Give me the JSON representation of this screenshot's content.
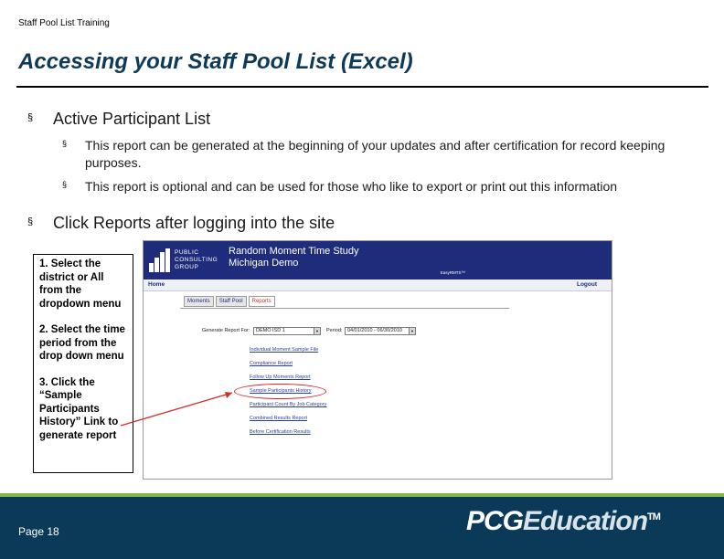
{
  "header": {
    "small_title": "Staff Pool List Training"
  },
  "slide": {
    "title": "Accessing your Staff Pool List (Excel)"
  },
  "bullets": {
    "b1": {
      "text": "Active Participant List",
      "sub1": "This report can be generated at the beginning of your updates and after certification for record keeping purposes.",
      "sub2": "This report is optional and can be used for those who like to export or print out this information"
    },
    "b2": {
      "text": "Click Reports after logging into the site"
    },
    "symbol": "§"
  },
  "callout": {
    "step1": "1. Select the district or All from the dropdown menu",
    "step2": "2. Select the time period from the drop down menu",
    "step3": "3. Click the “Sample Participants History” Link to generate report"
  },
  "screenshot": {
    "logo_lines": [
      "PUBLIC",
      "CONSULTING",
      "GROUP"
    ],
    "app_title_1": "Random Moment Time Study",
    "app_title_2": "Michigan Demo",
    "subtag": "EasyRMTS™",
    "home": "Home",
    "logout": "Logout",
    "tabs": [
      "Moments",
      "Staff Pool",
      "Reports"
    ],
    "generate_label": "Generate Report For:",
    "generate_value": "DEMO ISD 1",
    "period_label": "Period:",
    "period_value": "04/01/2010 - 06/30/2010",
    "links": [
      "Individual Moment Sample File",
      "Compliance Report",
      "Follow Up Moments Report",
      "Sample Participants History",
      "Participant Count By Job Category",
      "Combined Results Report",
      "Before Certification Results"
    ]
  },
  "footer": {
    "page": "Page 18",
    "brand_pcg": "PCG",
    "brand_edu": "Education",
    "brand_tm": "TM",
    "colors": {
      "footer_bg": "#0b3a59",
      "accent": "#86b64b"
    }
  }
}
